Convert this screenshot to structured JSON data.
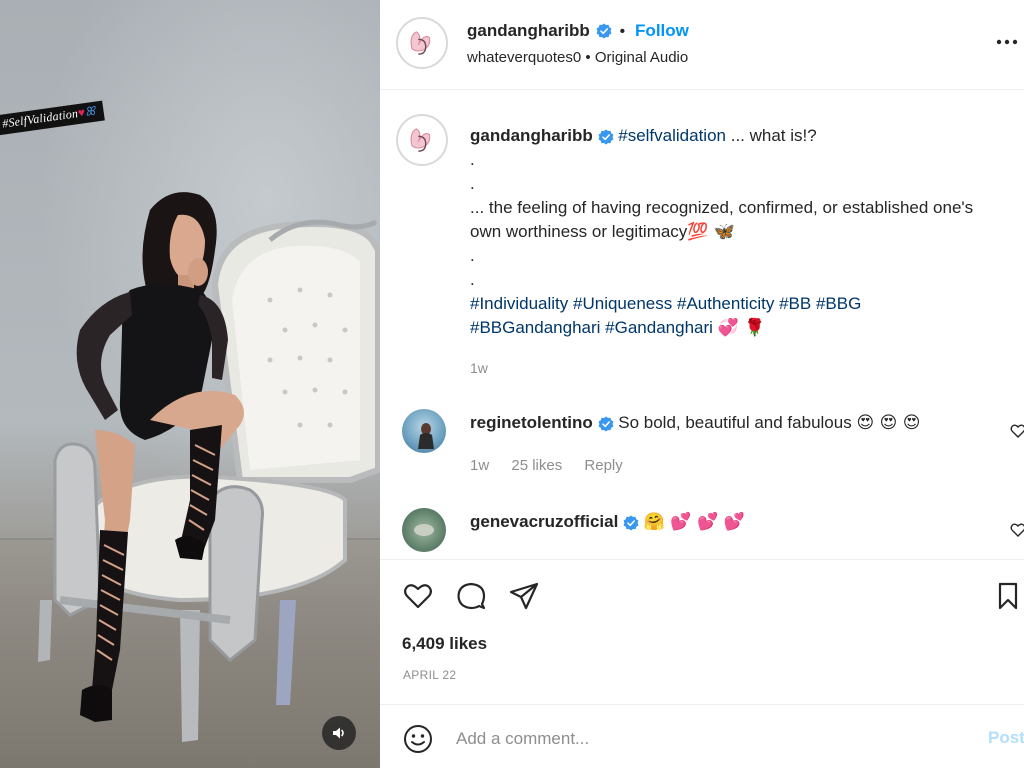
{
  "media": {
    "sticker_text": "#SelfValidation",
    "sticker_heart": "♥",
    "sticker_butterfly": "ꕤ"
  },
  "header": {
    "username": "gandangharibb",
    "separator": "•",
    "follow_label": "Follow",
    "audio_user": "whateverquotes0",
    "audio_sep": " • ",
    "audio_label": "Original Audio"
  },
  "caption": {
    "username": "gandangharibb",
    "hashtag_1": "#selfvalidation",
    "text_1": " ... what is!?",
    "dot_1": ".",
    "dot_2": ".",
    "text_2": "... the feeling of having recognized, confirmed, or established one's",
    "text_3": "own worthiness or legitimacy",
    "emoji_1": "💯 🦋",
    "dot_3": ".",
    "dot_4": ".",
    "tags_line_1": [
      "#Individuality",
      "#Uniqueness",
      "#Authenticity",
      "#BB",
      "#BBG"
    ],
    "tags_line_2": [
      "#BBGandanghari",
      "#Gandanghari"
    ],
    "emoji_2": "💞 🌹",
    "age": "1w"
  },
  "comments": [
    {
      "username": "reginetolentino",
      "text": "So bold, beautiful and fabulous",
      "emoji": "😍 😍 😍",
      "age": "1w",
      "likes": "25 likes",
      "reply": "Reply"
    },
    {
      "username": "genevacruzofficial",
      "text": "",
      "emoji": "🤗 💕 💕 💕"
    }
  ],
  "actions": {
    "likes": "6,409 likes",
    "date": "APRIL 22"
  },
  "add_comment": {
    "placeholder": "Add a comment...",
    "post_label": "Post"
  },
  "colors": {
    "link_blue": "#0095f6",
    "hashtag_blue": "#00376b",
    "verified_blue": "#3897f0",
    "muted": "#8e8e8e",
    "post_disabled": "#b2dffc"
  },
  "icons": {
    "verified": "verified-badge-icon",
    "more": "more-options-icon",
    "like": "heart-icon",
    "comment": "comment-icon",
    "share": "share-icon",
    "save": "bookmark-icon",
    "emoji": "emoji-icon",
    "volume": "volume-icon"
  }
}
